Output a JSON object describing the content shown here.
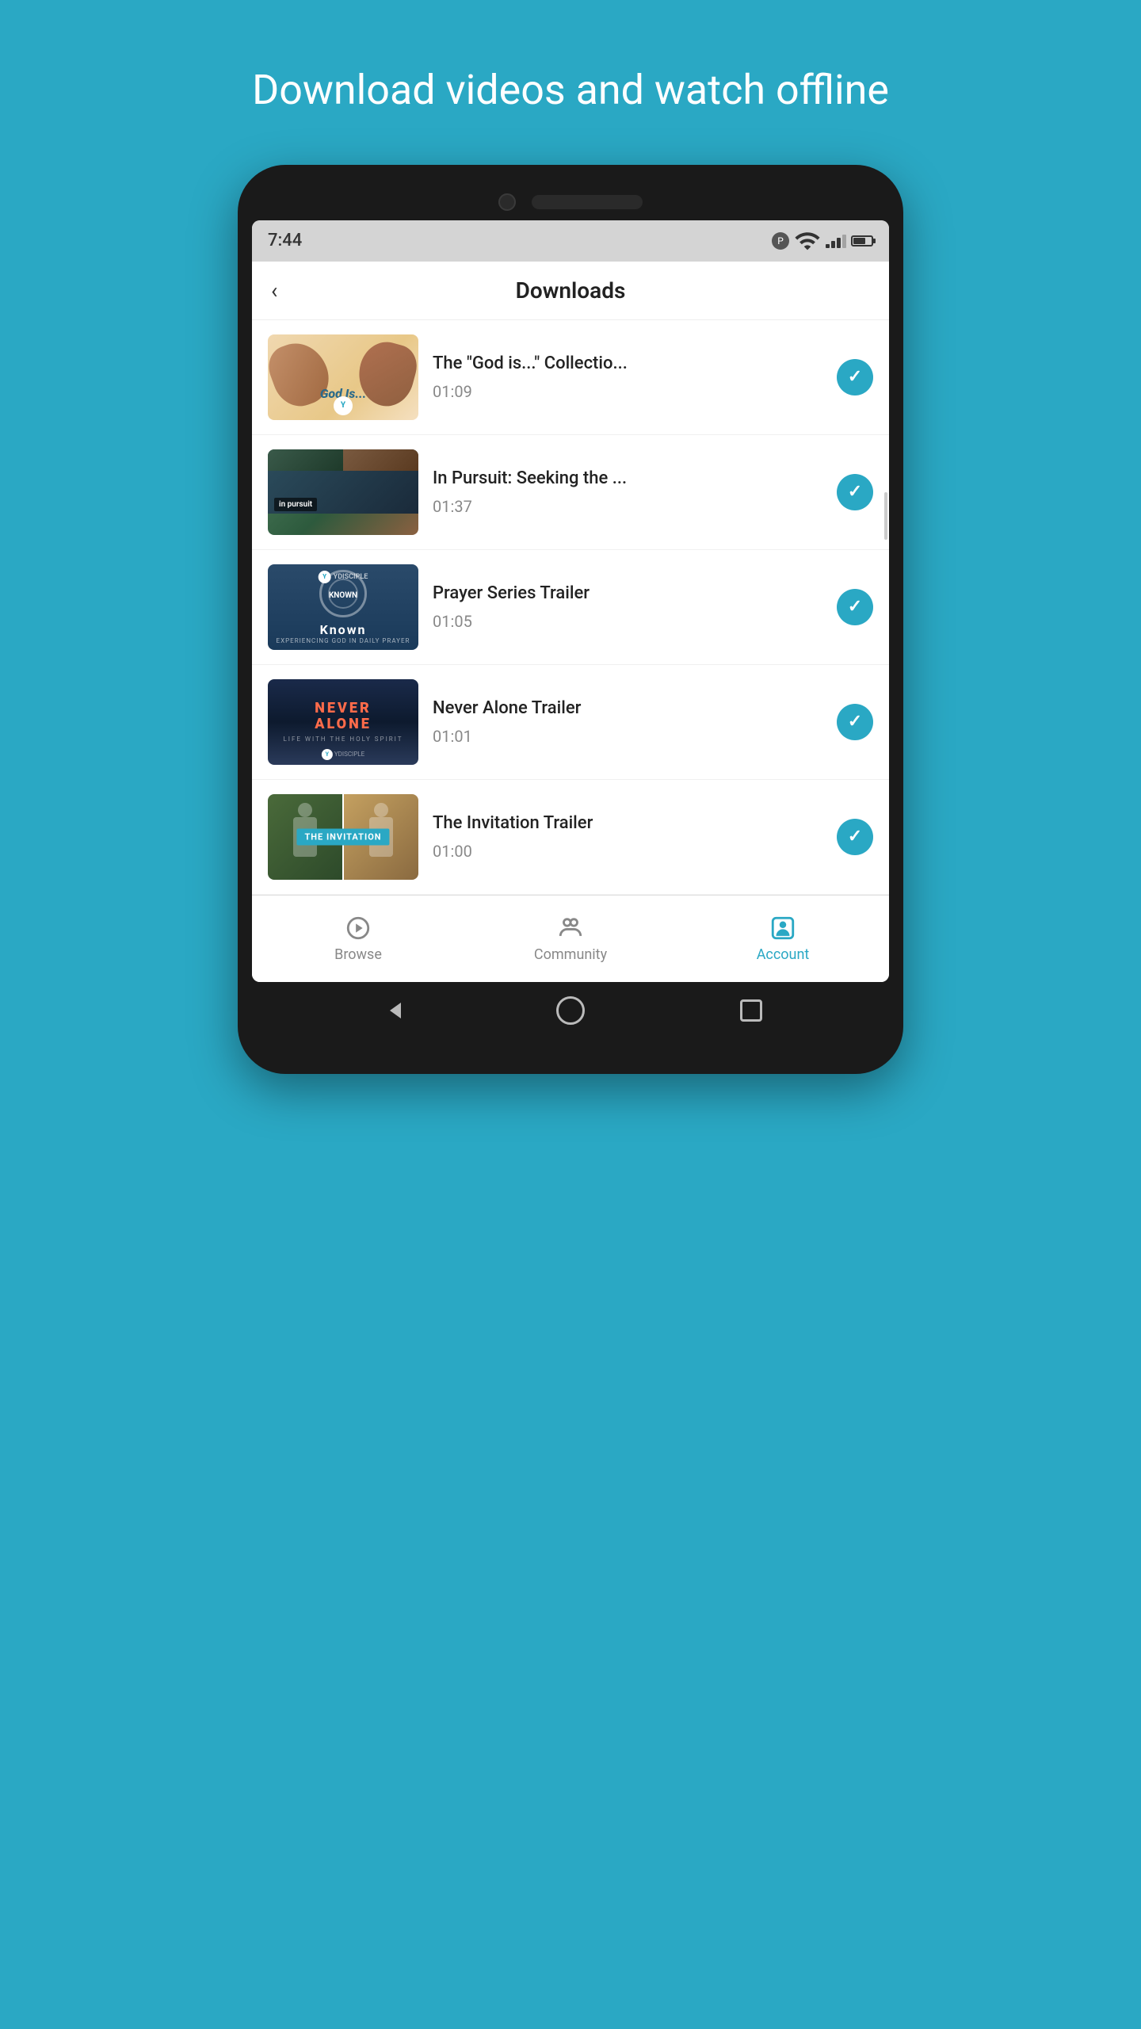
{
  "page": {
    "background_color": "#2aa8c4",
    "promo_title": "Download videos and watch offline"
  },
  "status_bar": {
    "time": "7:44",
    "app_indicator": "P"
  },
  "header": {
    "back_label": "‹",
    "title": "Downloads"
  },
  "videos": [
    {
      "id": "god-is",
      "title": "The \"God is...\" Collectio...",
      "duration": "01:09",
      "downloaded": true,
      "thumb_type": "god-is"
    },
    {
      "id": "in-pursuit",
      "title": "In Pursuit: Seeking the ...",
      "duration": "01:37",
      "downloaded": true,
      "thumb_type": "pursuit"
    },
    {
      "id": "prayer-series",
      "title": "Prayer Series Trailer",
      "duration": "01:05",
      "downloaded": true,
      "thumb_type": "known"
    },
    {
      "id": "never-alone",
      "title": "Never Alone Trailer",
      "duration": "01:01",
      "downloaded": true,
      "thumb_type": "never-alone"
    },
    {
      "id": "invitation",
      "title": "The Invitation Trailer",
      "duration": "01:00",
      "downloaded": true,
      "thumb_type": "invitation"
    }
  ],
  "bottom_nav": {
    "items": [
      {
        "id": "browse",
        "label": "Browse",
        "active": false,
        "icon": "browse-icon"
      },
      {
        "id": "community",
        "label": "Community",
        "active": false,
        "icon": "community-icon"
      },
      {
        "id": "account",
        "label": "Account",
        "active": true,
        "icon": "account-icon"
      }
    ]
  },
  "phone_nav": {
    "back": "◀",
    "home": "●",
    "recent": "■"
  }
}
